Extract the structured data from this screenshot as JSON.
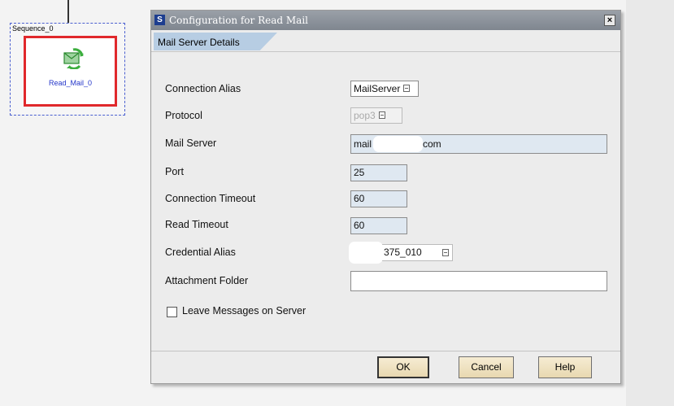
{
  "sequence": {
    "label": "Sequence_0",
    "step_label": "Read_Mail_0"
  },
  "dialog": {
    "title": "Configuration for Read Mail",
    "close_glyph": "×",
    "tab": "Mail Server Details",
    "fields": {
      "connection_alias": {
        "label": "Connection Alias",
        "value": "MailServer"
      },
      "protocol": {
        "label": "Protocol",
        "value": "pop3"
      },
      "mail_server": {
        "label": "Mail Server",
        "value_prefix": "mail",
        "value_suffix": "com"
      },
      "port": {
        "label": "Port",
        "value": "25"
      },
      "connection_timeout": {
        "label": "Connection Timeout",
        "value": "60"
      },
      "read_timeout": {
        "label": "Read Timeout",
        "value": "60"
      },
      "credential_alias": {
        "label": "Credential Alias",
        "value": "375_010"
      },
      "attachment_folder": {
        "label": "Attachment Folder",
        "value": ""
      }
    },
    "leave_messages": {
      "label": "Leave Messages on Server",
      "checked": false
    },
    "buttons": {
      "ok": "OK",
      "cancel": "Cancel",
      "help": "Help"
    }
  }
}
